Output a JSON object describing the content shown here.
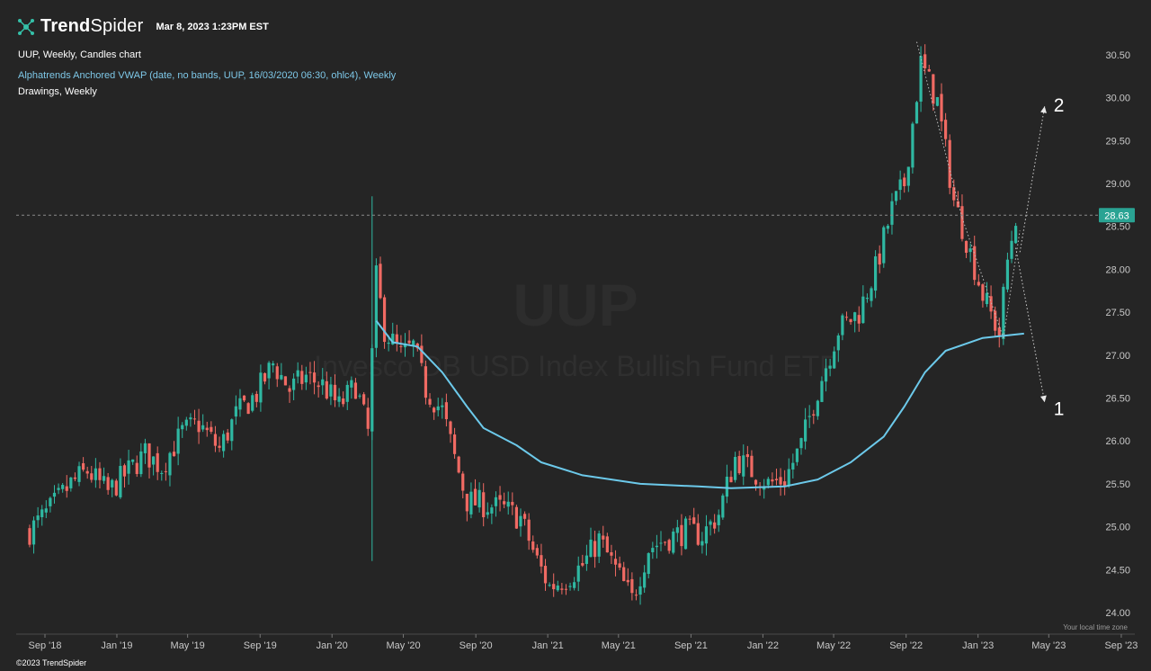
{
  "header": {
    "brand_bold": "Trend",
    "brand_light": "Spider",
    "datetime": "Mar 8, 2023 1:23PM EST",
    "symbol_line": "UUP, Weekly, Candles chart",
    "indicator_line": "Alphatrends Anchored VWAP (date, no bands, UUP, 16/03/2020 06:30, ohlc4), Weekly",
    "drawings_line": "Drawings, Weekly"
  },
  "watermark": {
    "symbol": "UUP",
    "name": "Invesco DB USD Index Bullish Fund ETF"
  },
  "footer": {
    "copyright": "©2023 TrendSpider",
    "timezone_note": "Your local time zone"
  },
  "colors": {
    "background": "#252525",
    "bull": "#2fb8a2",
    "bear": "#f06a63",
    "vwap": "#6cc9ea",
    "price_tag": "#2aa393",
    "axis_text": "#c8c8c8",
    "indicator_text": "#7ec8e8"
  },
  "chart_data": {
    "type": "candlestick",
    "title": "UUP",
    "timeframe": "Weekly",
    "ylim": [
      24.0,
      30.5
    ],
    "y_ticks": [
      24.0,
      24.5,
      25.0,
      25.5,
      26.0,
      26.5,
      27.0,
      27.5,
      28.0,
      28.5,
      29.0,
      29.5,
      30.0,
      30.5
    ],
    "x_ticks": [
      "Sep '18",
      "Jan '19",
      "May '19",
      "Sep '19",
      "Jan '20",
      "May '20",
      "Sep '20",
      "Jan '21",
      "May '21",
      "Sep '21",
      "Jan '22",
      "May '22",
      "Sep '22",
      "Jan '23",
      "May '23",
      "Sep '23"
    ],
    "last_price": 28.63,
    "price_path": [
      [
        "2018-08-06",
        24.95
      ],
      [
        "2018-09-10",
        25.2
      ],
      [
        "2018-10-15",
        25.5
      ],
      [
        "2018-11-12",
        25.65
      ],
      [
        "2018-12-17",
        25.4
      ],
      [
        "2019-01-14",
        25.6
      ],
      [
        "2019-02-18",
        25.85
      ],
      [
        "2019-03-18",
        25.7
      ],
      [
        "2019-04-22",
        26.1
      ],
      [
        "2019-05-20",
        26.2
      ],
      [
        "2019-06-24",
        25.9
      ],
      [
        "2019-07-22",
        26.3
      ],
      [
        "2019-08-26",
        26.55
      ],
      [
        "2019-09-23",
        26.9
      ],
      [
        "2019-10-21",
        26.6
      ],
      [
        "2019-11-18",
        26.75
      ],
      [
        "2019-12-16",
        26.65
      ],
      [
        "2020-01-13",
        26.4
      ],
      [
        "2020-02-10",
        26.65
      ],
      [
        "2020-03-02",
        26.1
      ],
      [
        "2020-03-16",
        27.9
      ],
      [
        "2020-03-30",
        27.3
      ],
      [
        "2020-04-27",
        27.0
      ],
      [
        "2020-05-18",
        27.1
      ],
      [
        "2020-06-08",
        26.6
      ],
      [
        "2020-07-06",
        26.35
      ],
      [
        "2020-07-27",
        25.8
      ],
      [
        "2020-08-17",
        25.3
      ],
      [
        "2020-09-21",
        25.25
      ],
      [
        "2020-10-19",
        25.2
      ],
      [
        "2020-11-16",
        25.1
      ],
      [
        "2020-12-14",
        24.6
      ],
      [
        "2021-01-04",
        24.3
      ],
      [
        "2021-02-01",
        24.4
      ],
      [
        "2021-03-01",
        24.55
      ],
      [
        "2021-03-29",
        24.85
      ],
      [
        "2021-04-26",
        24.5
      ],
      [
        "2021-05-24",
        24.15
      ],
      [
        "2021-06-21",
        24.75
      ],
      [
        "2021-07-19",
        24.85
      ],
      [
        "2021-08-23",
        24.95
      ],
      [
        "2021-09-20",
        24.9
      ],
      [
        "2021-10-18",
        25.15
      ],
      [
        "2021-11-15",
        25.8
      ],
      [
        "2021-12-13",
        25.65
      ],
      [
        "2022-01-10",
        25.5
      ],
      [
        "2022-02-07",
        25.55
      ],
      [
        "2022-03-07",
        25.95
      ],
      [
        "2022-04-04",
        26.6
      ],
      [
        "2022-05-09",
        27.3
      ],
      [
        "2022-06-13",
        27.5
      ],
      [
        "2022-07-11",
        28.0
      ],
      [
        "2022-08-08",
        28.7
      ],
      [
        "2022-08-29",
        29.0
      ],
      [
        "2022-09-26",
        30.4
      ],
      [
        "2022-10-24",
        29.95
      ],
      [
        "2022-11-21",
        28.8
      ],
      [
        "2022-12-12",
        28.35
      ],
      [
        "2023-01-09",
        27.7
      ],
      [
        "2023-02-06",
        27.25
      ],
      [
        "2023-02-20",
        28.1
      ],
      [
        "2023-03-06",
        28.63
      ]
    ],
    "vwap": {
      "name": "Alphatrends Anchored VWAP",
      "anchor": "2020-03-16",
      "points": [
        [
          "2020-03-16",
          27.4
        ],
        [
          "2020-04-13",
          27.15
        ],
        [
          "2020-05-25",
          27.1
        ],
        [
          "2020-07-06",
          26.8
        ],
        [
          "2020-08-17",
          26.4
        ],
        [
          "2020-09-14",
          26.15
        ],
        [
          "2020-11-09",
          25.95
        ],
        [
          "2020-12-21",
          25.75
        ],
        [
          "2021-03-01",
          25.6
        ],
        [
          "2021-06-07",
          25.5
        ],
        [
          "2021-09-13",
          25.47
        ],
        [
          "2021-11-08",
          25.45
        ],
        [
          "2022-02-07",
          25.47
        ],
        [
          "2022-04-04",
          25.55
        ],
        [
          "2022-05-30",
          25.75
        ],
        [
          "2022-07-25",
          26.05
        ],
        [
          "2022-08-29",
          26.4
        ],
        [
          "2022-10-03",
          26.8
        ],
        [
          "2022-11-07",
          27.05
        ],
        [
          "2023-01-09",
          27.2
        ],
        [
          "2023-03-20",
          27.25
        ]
      ]
    },
    "projections": [
      {
        "label": "2",
        "start": [
          "2023-03-13",
          28.2
        ],
        "end": [
          "2023-04-24",
          29.9
        ]
      },
      {
        "label": "1",
        "start": [
          "2023-03-06",
          28.25
        ],
        "end": [
          "2023-04-24",
          26.45
        ]
      }
    ]
  }
}
